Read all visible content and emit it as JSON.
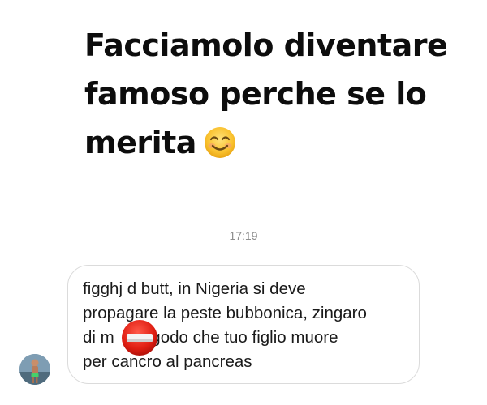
{
  "headline": {
    "lines": [
      "Facciamolo diventare",
      "famoso perche se lo",
      "merita"
    ],
    "emoji": "smiling-face-icon"
  },
  "timestamp": "17:19",
  "message": {
    "lines": [
      "figghj d butt, in Nigeria si deve",
      "propagare la peste bubbonica, zingaro",
      "di m        godo che tuo figlio muore",
      "per cancro al pancreas"
    ],
    "overlay_emoji": "no-entry-icon"
  },
  "avatar": "user-avatar"
}
